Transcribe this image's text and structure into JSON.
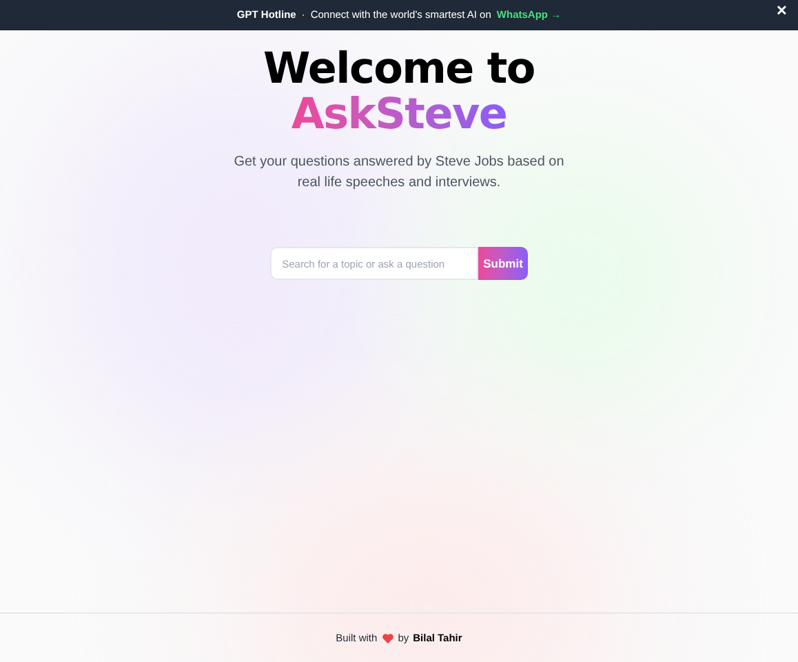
{
  "banner": {
    "title": "GPT Hotline",
    "separator": "·",
    "message": "Connect with the world's smartest AI on",
    "link": "WhatsApp →",
    "close": "✕"
  },
  "hero": {
    "title_line_1": "Welcome to",
    "title_line_2": "AskSteve",
    "subtitle": "Get your questions answered by Steve Jobs based on real life speeches and interviews."
  },
  "search": {
    "placeholder": "Search for a topic or ask a question",
    "button": "Submit"
  },
  "footer": {
    "prefix": "Built with",
    "middle": "by",
    "author": "Bilal Tahir"
  }
}
